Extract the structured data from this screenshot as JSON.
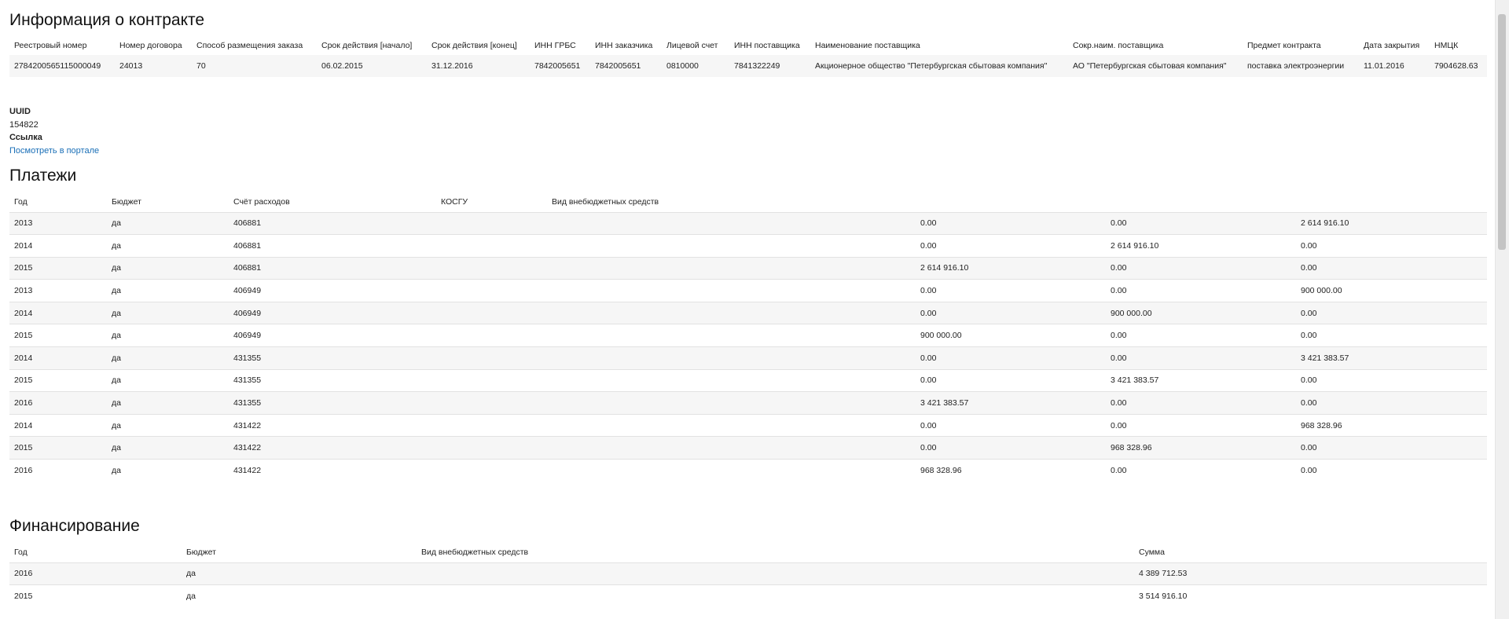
{
  "contract": {
    "title": "Информация о контракте",
    "headers": [
      "Реестровый номер",
      "Номер договора",
      "Способ размещения заказа",
      "Срок действия [начало]",
      "Срок действия [конец]",
      "ИНН ГРБС",
      "ИНН заказчика",
      "Лицевой счет",
      "ИНН поставщика",
      "Наименование поставщика",
      "Сокр.наим. поставщика",
      "Предмет контракта",
      "Дата закрытия",
      "НМЦК"
    ],
    "row": [
      "2784200565115000049",
      "24013",
      "70",
      "06.02.2015",
      "31.12.2016",
      "7842005651",
      "7842005651",
      "0810000",
      "7841322249",
      "Акционерное общество \"Петербургская сбытовая компания\"",
      "АО \"Петербургская сбытовая компания\"",
      "поставка электроэнергии",
      "11.01.2016",
      "7904628.63"
    ]
  },
  "meta": {
    "uuid_label": "UUID",
    "uuid_value": "154822",
    "link_label": "Ссылка",
    "link_text": "Посмотреть в портале"
  },
  "payments": {
    "title": "Платежи",
    "headers": [
      "Год",
      "Бюджет",
      "Счёт расходов",
      "КОСГУ",
      "Вид внебюджетных средств",
      "",
      "",
      ""
    ],
    "rows": [
      [
        "2013",
        "да",
        "406881",
        "",
        "",
        "0.00",
        "0.00",
        "2 614 916.10"
      ],
      [
        "2014",
        "да",
        "406881",
        "",
        "",
        "0.00",
        "2 614 916.10",
        "0.00"
      ],
      [
        "2015",
        "да",
        "406881",
        "",
        "",
        "2 614 916.10",
        "0.00",
        "0.00"
      ],
      [
        "2013",
        "да",
        "406949",
        "",
        "",
        "0.00",
        "0.00",
        "900 000.00"
      ],
      [
        "2014",
        "да",
        "406949",
        "",
        "",
        "0.00",
        "900 000.00",
        "0.00"
      ],
      [
        "2015",
        "да",
        "406949",
        "",
        "",
        "900 000.00",
        "0.00",
        "0.00"
      ],
      [
        "2014",
        "да",
        "431355",
        "",
        "",
        "0.00",
        "0.00",
        "3 421 383.57"
      ],
      [
        "2015",
        "да",
        "431355",
        "",
        "",
        "0.00",
        "3 421 383.57",
        "0.00"
      ],
      [
        "2016",
        "да",
        "431355",
        "",
        "",
        "3 421 383.57",
        "0.00",
        "0.00"
      ],
      [
        "2014",
        "да",
        "431422",
        "",
        "",
        "0.00",
        "0.00",
        "968 328.96"
      ],
      [
        "2015",
        "да",
        "431422",
        "",
        "",
        "0.00",
        "968 328.96",
        "0.00"
      ],
      [
        "2016",
        "да",
        "431422",
        "",
        "",
        "968 328.96",
        "0.00",
        "0.00"
      ]
    ]
  },
  "financing": {
    "title": "Финансирование",
    "headers": [
      "Год",
      "Бюджет",
      "Вид внебюджетных средств",
      "Сумма"
    ],
    "rows": [
      [
        "2016",
        "да",
        "",
        "4 389 712.53"
      ],
      [
        "2015",
        "да",
        "",
        "3 514 916.10"
      ]
    ]
  }
}
